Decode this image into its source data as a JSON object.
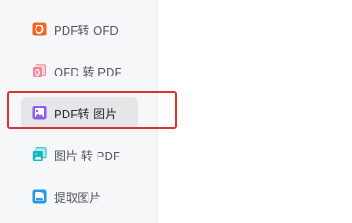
{
  "sidebar": {
    "items": [
      {
        "label": "PDF转 OFD",
        "icon": "pdf-to-ofd-icon",
        "color": "#f26522",
        "active": false
      },
      {
        "label": "OFD 转 PDF",
        "icon": "ofd-to-pdf-icon",
        "color": "#f08a9a",
        "active": false
      },
      {
        "label": "PDF转 图片",
        "icon": "pdf-to-image-icon",
        "color": "#8b5cf6",
        "active": true
      },
      {
        "label": "图片 转 PDF",
        "icon": "image-to-pdf-icon",
        "color": "#14b8c4",
        "active": false
      },
      {
        "label": "提取图片",
        "icon": "extract-image-icon",
        "color": "#1e9be6",
        "active": false
      }
    ]
  },
  "annotation": {
    "highlight_color": "#e03030"
  }
}
